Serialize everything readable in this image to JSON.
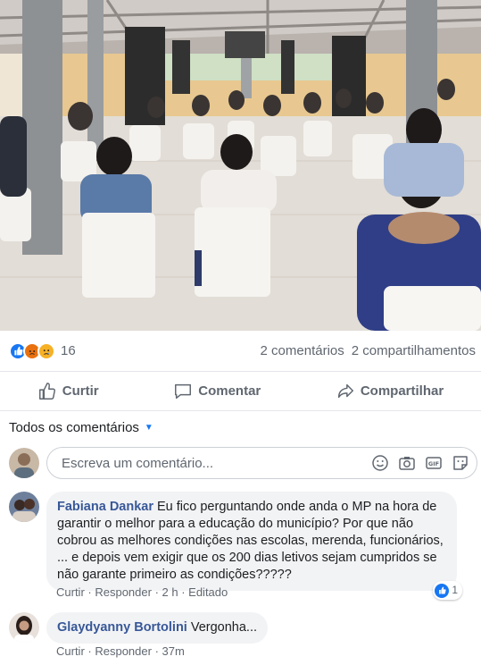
{
  "post": {
    "reaction_count": "16",
    "comments_count": "2 comentários",
    "shares_count": "2 compartilhamentos",
    "reactions": [
      "like-reaction-icon",
      "angry-reaction-icon",
      "sad-reaction-icon"
    ]
  },
  "actions": {
    "like": "Curtir",
    "comment": "Comentar",
    "share": "Compartilhar"
  },
  "comments_section": {
    "filter_label": "Todos os comentários",
    "composer_placeholder": "Escreva um comentário...",
    "composer_icons": [
      "emoji-icon",
      "camera-icon",
      "gif-icon",
      "sticker-icon"
    ]
  },
  "comments": [
    {
      "author": "Fabiana Dankar",
      "text": "Eu fico perguntando onde anda o MP na hora de garantir o melhor para a educação do município? Por que não cobrou as melhores condições nas escolas, merenda, funcionários, ... e depois vem exigir que os 200 dias letivos sejam cumpridos se não garante primeiro as condições?????",
      "like": "Curtir",
      "reply": "Responder",
      "time": "2 h",
      "edited": "Editado",
      "reaction_count": "1"
    },
    {
      "author": "Glaydyanny Bortolini",
      "text": "Vergonha...",
      "like": "Curtir",
      "reply": "Responder",
      "time": "37m"
    }
  ],
  "colors": {
    "facebook_blue": "#1877f2",
    "link_blue": "#385898",
    "muted": "#606770",
    "bubble": "#f2f3f5"
  }
}
